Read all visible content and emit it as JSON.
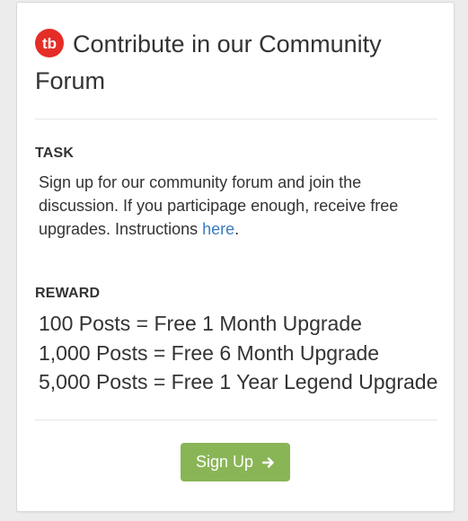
{
  "card": {
    "title": "Contribute in our Community Forum",
    "logo_icon": "tubebuddy-logo-icon",
    "brand_color": "#e52d27"
  },
  "task": {
    "label": "TASK",
    "text": "Sign up for our community forum and join the discussion. If you participage enough, receive free upgrades. Instructions ",
    "link_text": "here",
    "suffix": "."
  },
  "reward": {
    "label": "REWARD",
    "items": [
      "100 Posts = Free 1 Month Upgrade",
      "1,000 Posts = Free 6 Month Upgrade",
      "5,000 Posts = Free 1 Year Legend Upgrade"
    ]
  },
  "button": {
    "label": "Sign Up",
    "icon": "arrow-right-icon",
    "color": "#8ab557"
  }
}
